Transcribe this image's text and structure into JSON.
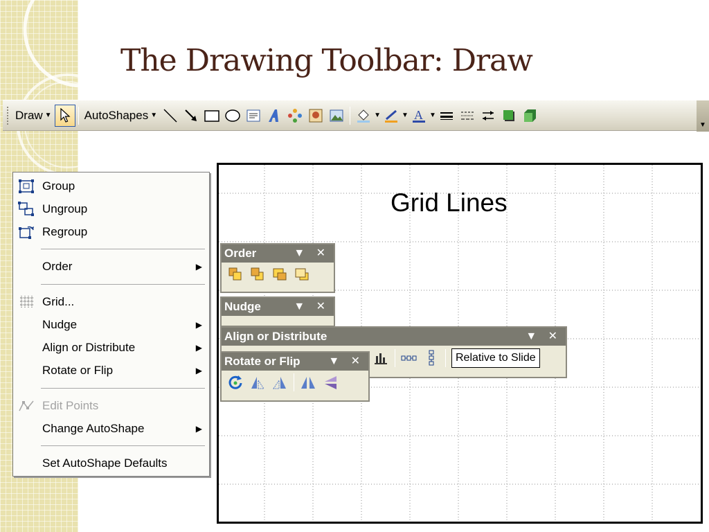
{
  "slide": {
    "title": "The Drawing Toolbar: Draw"
  },
  "colors": {
    "title_color": "#4a2318",
    "strip_color": "#e9e2ae",
    "titlebar_color": "#7b7a70"
  },
  "toolbar": {
    "draw_label": "Draw",
    "autoshapes_label": "AutoShapes",
    "icons": [
      "select-objects-icon",
      "line-icon",
      "arrow-icon",
      "rectangle-icon",
      "oval-icon",
      "text-box-icon",
      "wordart-icon",
      "diagram-icon",
      "clip-art-icon",
      "picture-icon",
      "fill-color-icon",
      "line-color-icon",
      "font-color-icon",
      "line-style-icon",
      "dash-style-icon",
      "arrow-style-icon",
      "shadow-style-icon",
      "3d-style-icon"
    ]
  },
  "canvas": {
    "title": "Grid Lines"
  },
  "draw_menu": {
    "items": [
      {
        "label": "Group",
        "icon": "group-icon",
        "submenu": false,
        "disabled": false
      },
      {
        "label": "Ungroup",
        "icon": "ungroup-icon",
        "submenu": false,
        "disabled": false
      },
      {
        "label": "Regroup",
        "icon": "regroup-icon",
        "submenu": false,
        "disabled": false
      },
      {
        "label": "Order",
        "icon": "",
        "submenu": true,
        "disabled": false
      },
      {
        "label": "Grid...",
        "icon": "grid-icon",
        "submenu": false,
        "disabled": false
      },
      {
        "label": "Nudge",
        "icon": "",
        "submenu": true,
        "disabled": false
      },
      {
        "label": "Align or Distribute",
        "icon": "",
        "submenu": true,
        "disabled": false
      },
      {
        "label": "Rotate or Flip",
        "icon": "",
        "submenu": true,
        "disabled": false
      },
      {
        "label": "Edit Points",
        "icon": "edit-points-icon",
        "submenu": false,
        "disabled": true
      },
      {
        "label": "Change AutoShape",
        "icon": "",
        "submenu": true,
        "disabled": false
      },
      {
        "label": "Set AutoShape Defaults",
        "icon": "",
        "submenu": false,
        "disabled": false
      }
    ]
  },
  "floating": {
    "order_title": "Order",
    "nudge_title": "Nudge",
    "align_title": "Align or Distribute",
    "rotate_title": "Rotate or Flip",
    "relative_label": "Relative to Slide",
    "title_controls": "▼ ✕"
  }
}
